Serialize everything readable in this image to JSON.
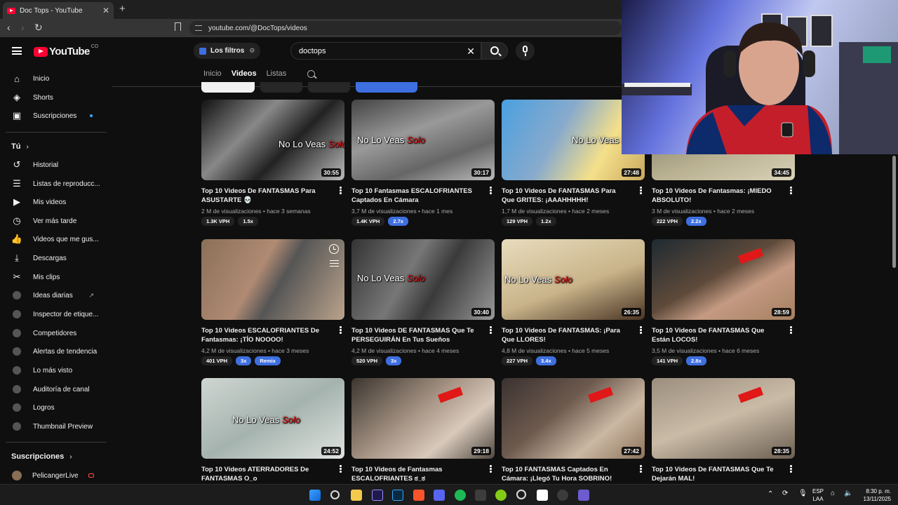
{
  "browser": {
    "tab_title": "Doc Tops - YouTube",
    "tab_close": "✕",
    "new_tab": "+",
    "url": "youtube.com/@DocTops/videos"
  },
  "header": {
    "logo_text": "YouTube",
    "country_code": "CO",
    "filters_label": "Los filtros",
    "search_value": "doctops"
  },
  "sidebar": {
    "main": [
      {
        "label": "Inicio",
        "icon": "home-icon"
      },
      {
        "label": "Shorts",
        "icon": "shorts-icon"
      },
      {
        "label": "Suscripciones",
        "icon": "subscriptions-icon"
      }
    ],
    "you_header": "Tú",
    "you_items": [
      {
        "label": "Historial",
        "icon": "history-icon"
      },
      {
        "label": "Listas de reproducc...",
        "icon": "playlists-icon"
      },
      {
        "label": "Mis videos",
        "icon": "my-videos-icon"
      },
      {
        "label": "Ver más tarde",
        "icon": "clock-icon"
      },
      {
        "label": "Videos que me gus...",
        "icon": "like-icon"
      },
      {
        "label": "Descargas",
        "icon": "download-icon"
      },
      {
        "label": "Mis clips",
        "icon": "scissors-icon"
      }
    ],
    "tool_items": [
      {
        "label": "Ideas diarias"
      },
      {
        "label": "Inspector de etique..."
      },
      {
        "label": "Competidores"
      },
      {
        "label": "Alertas de tendencia"
      },
      {
        "label": "Lo más visto"
      },
      {
        "label": "Auditoría de canal"
      },
      {
        "label": "Logros"
      },
      {
        "label": "Thumbnail Preview"
      }
    ],
    "subs_header": "Suscripciones",
    "subs_items": [
      {
        "label": "PelicangerLive"
      }
    ]
  },
  "channel_tabs": [
    "Inicio",
    "Videos",
    "Listas"
  ],
  "videos": [
    {
      "title": "Top 10 Videos De FANTASMAS Para ASUSTARTE 💀",
      "meta": "2 M de visualizaciones • hace 3 semanas",
      "duration": "30:55",
      "vph": "1.3K VPH",
      "mult": "1.5x",
      "mult_blue": false
    },
    {
      "title": "Top 10 Fantasmas ESCALOFRIANTES Captados En Cámara",
      "meta": "3,7 M de visualizaciones • hace 1 mes",
      "duration": "30:17",
      "vph": "1.4K VPH",
      "mult": "2.7x",
      "mult_blue": true
    },
    {
      "title": "Top 10 Videos De FANTASMAS Para Que GRITES: ¡AAAHHHHH!",
      "meta": "1,7 M de visualizaciones • hace 2 meses",
      "duration": "27:48",
      "vph": "129 VPH",
      "mult": "1.2x",
      "mult_blue": false
    },
    {
      "title": "Top 10 Videos De Fantasmas: ¡MIEDO ABSOLUTO!",
      "meta": "3 M de visualizaciones • hace 2 meses",
      "duration": "34:45",
      "vph": "222 VPH",
      "mult": "2.2x",
      "mult_blue": true
    },
    {
      "title": "Top 10 Videos ESCALOFRIANTES De Fantasmas: ¡TÍO NOOOO!",
      "meta": "4,2 M de visualizaciones • hace 3 meses",
      "duration": "",
      "vph": "401 VPH",
      "mult": "3x",
      "mult_blue": true,
      "extra": "Remix"
    },
    {
      "title": "Top 10 Videos DE FANTASMAS Que Te PERSEGUIRÁN En Tus Sueños",
      "meta": "4,2 M de visualizaciones • hace 4 meses",
      "duration": "30:40",
      "vph": "520 VPH",
      "mult": "3x",
      "mult_blue": true
    },
    {
      "title": "Top 10 Videos De FANTASMAS: ¡Para Que LLORES!",
      "meta": "4,8 M de visualizaciones • hace 5 meses",
      "duration": "26:35",
      "vph": "227 VPH",
      "mult": "3.4x",
      "mult_blue": true
    },
    {
      "title": "Top 10 Videos De FANTASMAS Que Están LOCOS!",
      "meta": "3,5 M de visualizaciones • hace 6 meses",
      "duration": "28:59",
      "vph": "141 VPH",
      "mult": "2.8x",
      "mult_blue": true
    },
    {
      "title": "Top 10 Videos ATERRADORES De FANTASMAS O_o",
      "meta": "",
      "duration": "24:52",
      "vph": "",
      "mult": "",
      "mult_blue": false
    },
    {
      "title": "Top 10 Videos de Fantasmas ESCALOFRIANTES ಠ_ಠ",
      "meta": "",
      "duration": "29:18",
      "vph": "",
      "mult": "",
      "mult_blue": false
    },
    {
      "title": "Top 10 FANTASMAS Captados En Cámara: ¡Llegó Tu Hora SOBRINO!",
      "meta": "",
      "duration": "27:42",
      "vph": "",
      "mult": "",
      "mult_blue": false
    },
    {
      "title": "Top 10 Videos De FANTASMAS Que Te Dejarán MAL!",
      "meta": "",
      "duration": "28:35",
      "vph": "",
      "mult": "",
      "mult_blue": false
    }
  ],
  "thumb_text": {
    "a": "No Lo Veas ",
    "b": "Solo"
  },
  "taskbar": {
    "lang_top": "ESP",
    "lang_bottom": "LAA",
    "time": "8:30 p. m.",
    "date": "13/11/2025"
  },
  "colors": {
    "accent_blue": "#3e6fe0",
    "youtube_red": "#ff0033"
  }
}
